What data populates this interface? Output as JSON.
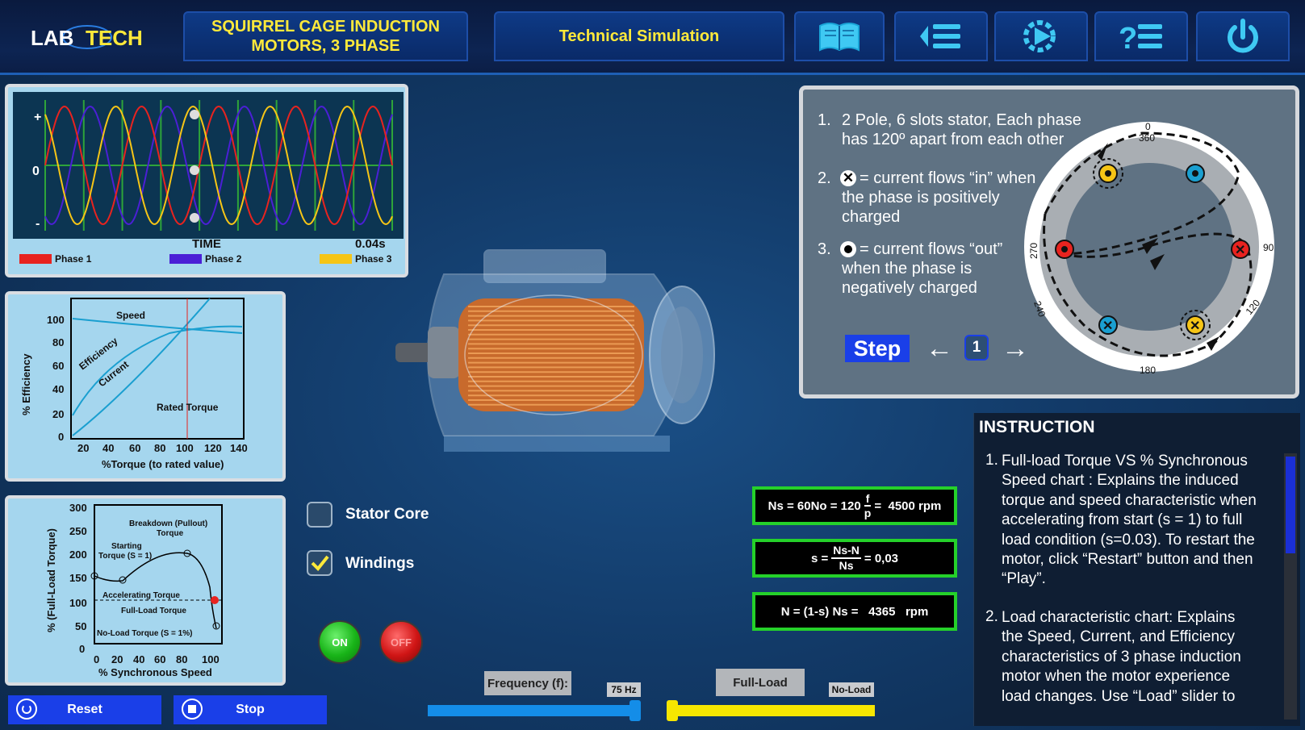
{
  "header": {
    "logo_text": "LAB TECH",
    "title_line1": "SQUIRREL CAGE INDUCTION",
    "title_line2": "MOTORS, 3 PHASE",
    "mode_button": "Technical Simulation",
    "icons": [
      "book-icon",
      "menu-list-icon",
      "play-gear-icon",
      "help-list-icon",
      "power-icon"
    ]
  },
  "waveform": {
    "plus": "+",
    "zero": "0",
    "minus": "-",
    "time_label": "TIME",
    "time_value": "0.04s",
    "legend": [
      {
        "name": "Phase 1",
        "color": "#e8231f"
      },
      {
        "name": "Phase 2",
        "color": "#4b1fd6"
      },
      {
        "name": "Phase 3",
        "color": "#f6c516"
      }
    ]
  },
  "load_chart": {
    "ylabel": "% Efficiency",
    "xlabel": "%Torque (to rated value)",
    "yticks": [
      "100",
      "80",
      "60",
      "40",
      "20",
      "0"
    ],
    "xticks": [
      "20",
      "40",
      "60",
      "80",
      "100",
      "120",
      "140"
    ],
    "labels": {
      "speed": "Speed",
      "efficiency": "Efficiency",
      "current": "Current",
      "rated": "Rated Torque"
    }
  },
  "torque_chart": {
    "ylabel": "% (Full-Load Torque)",
    "xlabel": "% Synchronous Speed",
    "yticks": [
      "300",
      "250",
      "200",
      "150",
      "100",
      "50",
      "0"
    ],
    "xticks": [
      "0",
      "20",
      "40",
      "60",
      "80",
      "100"
    ],
    "labels": {
      "breakdown": "Breakdown (Pullout)",
      "breakdown2": "Torque",
      "starting": "Starting",
      "starting2": "Torque (S = 1)",
      "accelerating": "Accelerating Torque",
      "fullload": "Full-Load Torque",
      "noload": "No-Load Torque (S = 1%)"
    }
  },
  "controls": {
    "stator_core": "Stator Core",
    "windings": "Windings",
    "on": "ON",
    "off": "OFF",
    "reset": "Reset",
    "stop": "Stop",
    "frequency_label": "Frequency (f):",
    "frequency_value": "75 Hz",
    "frequency_level": 1.0,
    "load_label": "Full-Load",
    "load_tag": "No-Load",
    "load_level": 0.0
  },
  "equations": {
    "ns_left": "Ns = 60No = 120",
    "ns_frac_num": "f",
    "ns_frac_den": "p",
    "ns_result": "=  4500 rpm",
    "s_left": "s =",
    "s_frac_num": "Ns-N",
    "s_frac_den": "Ns",
    "s_result": "= 0,03",
    "n_eq": "N = (1-s) Ns =   4365   rpm"
  },
  "stator_info": {
    "item1_num": "1.",
    "item1_line1": "2 Pole, 6 slots stator, Each phase",
    "item1_line2": "has 120º apart from each other",
    "item2_num": "2.",
    "item2_line1": "= current flows “in” when",
    "item2_line2": "the phase is positively",
    "item2_line3": "charged",
    "item3_num": "3.",
    "item3_line1": "= current flows “out”",
    "item3_line2": "when the phase is",
    "item3_line3": "negatively charged",
    "step_label": "Step",
    "step_value": "1",
    "deg_0": "0",
    "deg_360": "360",
    "deg_90": "90",
    "deg_120": "120",
    "deg_180": "180",
    "deg_240": "240",
    "deg_270": "270"
  },
  "instruction": {
    "title": "INSTRUCTION",
    "item1_num": "1.",
    "item1_lines": [
      "Full-load Torque  VS  % Synchronous",
      "Speed chart : Explains the induced",
      "torque and speed characteristic when",
      "accelerating from start (s = 1) to full",
      "load condition (s=0.03). To restart the",
      "motor, click “Restart” button and then",
      "“Play”."
    ],
    "item2_num": "2.",
    "item2_lines": [
      "Load characteristic chart: Explains",
      "the Speed, Current, and Efficiency",
      "characteristics of 3 phase induction",
      "motor when the motor experience",
      "load changes. Use “Load” slider to"
    ]
  }
}
